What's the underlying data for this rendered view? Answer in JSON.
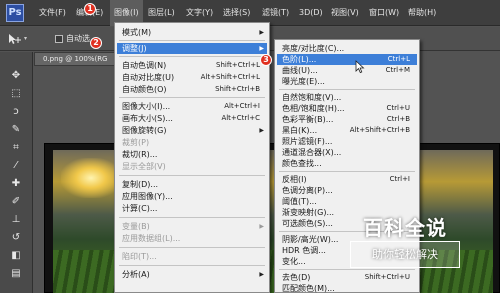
{
  "app": {
    "logo": "Ps"
  },
  "menubar": {
    "items": [
      {
        "label": "文件(F)"
      },
      {
        "label": "编辑(E)"
      },
      {
        "label": "图像(I)"
      },
      {
        "label": "图层(L)"
      },
      {
        "label": "文字(Y)"
      },
      {
        "label": "选择(S)"
      },
      {
        "label": "滤镜(T)"
      },
      {
        "label": "3D(D)"
      },
      {
        "label": "视图(V)"
      },
      {
        "label": "窗口(W)"
      },
      {
        "label": "帮助(H)"
      }
    ]
  },
  "options": {
    "auto_select_label": "自动选"
  },
  "document": {
    "tab_label": "0.png @ 100%(RG"
  },
  "image_menu": {
    "items": [
      {
        "label": "模式(M)",
        "shortcut": "",
        "submenu": true,
        "disabled": false
      },
      {
        "label": "调整(J)",
        "shortcut": "",
        "submenu": true,
        "disabled": false,
        "highlighted": true
      },
      {
        "label": "自动色调(N)",
        "shortcut": "Shift+Ctrl+L",
        "disabled": false
      },
      {
        "label": "自动对比度(U)",
        "shortcut": "Alt+Shift+Ctrl+L",
        "disabled": false
      },
      {
        "label": "自动颜色(O)",
        "shortcut": "Shift+Ctrl+B",
        "disabled": false
      },
      {
        "label": "图像大小(I)...",
        "shortcut": "Alt+Ctrl+I",
        "disabled": false
      },
      {
        "label": "画布大小(S)...",
        "shortcut": "Alt+Ctrl+C",
        "disabled": false
      },
      {
        "label": "图像旋转(G)",
        "shortcut": "",
        "submenu": true,
        "disabled": false
      },
      {
        "label": "裁剪(P)",
        "shortcut": "",
        "disabled": true
      },
      {
        "label": "裁切(R)...",
        "shortcut": "",
        "disabled": false
      },
      {
        "label": "显示全部(V)",
        "shortcut": "",
        "disabled": true
      },
      {
        "label": "复制(D)...",
        "shortcut": "",
        "disabled": false
      },
      {
        "label": "应用图像(Y)...",
        "shortcut": "",
        "disabled": false
      },
      {
        "label": "计算(C)...",
        "shortcut": "",
        "disabled": false
      },
      {
        "label": "变量(B)",
        "shortcut": "",
        "submenu": true,
        "disabled": true
      },
      {
        "label": "应用数据组(L)...",
        "shortcut": "",
        "disabled": true
      },
      {
        "label": "陷印(T)...",
        "shortcut": "",
        "disabled": true
      },
      {
        "label": "分析(A)",
        "shortcut": "",
        "submenu": true,
        "disabled": false
      }
    ]
  },
  "adjust_menu": {
    "items": [
      {
        "label": "亮度/对比度(C)...",
        "shortcut": ""
      },
      {
        "label": "色阶(L)...",
        "shortcut": "Ctrl+L",
        "highlighted": true
      },
      {
        "label": "曲线(U)...",
        "shortcut": "Ctrl+M"
      },
      {
        "label": "曝光度(E)...",
        "shortcut": ""
      },
      {
        "label": "自然饱和度(V)...",
        "shortcut": ""
      },
      {
        "label": "色相/饱和度(H)...",
        "shortcut": "Ctrl+U"
      },
      {
        "label": "色彩平衡(B)...",
        "shortcut": "Ctrl+B"
      },
      {
        "label": "黑白(K)...",
        "shortcut": "Alt+Shift+Ctrl+B"
      },
      {
        "label": "照片滤镜(F)...",
        "shortcut": ""
      },
      {
        "label": "通道混合器(X)...",
        "shortcut": ""
      },
      {
        "label": "颜色查找...",
        "shortcut": ""
      },
      {
        "label": "反相(I)",
        "shortcut": "Ctrl+I"
      },
      {
        "label": "色调分离(P)...",
        "shortcut": ""
      },
      {
        "label": "阈值(T)...",
        "shortcut": ""
      },
      {
        "label": "渐变映射(G)...",
        "shortcut": ""
      },
      {
        "label": "可选颜色(S)...",
        "shortcut": ""
      },
      {
        "label": "阴影/高光(W)...",
        "shortcut": ""
      },
      {
        "label": "HDR 色调...",
        "shortcut": ""
      },
      {
        "label": "变化...",
        "shortcut": ""
      },
      {
        "label": "去色(D)",
        "shortcut": "Shift+Ctrl+U"
      },
      {
        "label": "匹配颜色(M)...",
        "shortcut": ""
      }
    ]
  },
  "callouts": [
    "1",
    "2",
    "3"
  ],
  "watermark": {
    "title": "百科全说",
    "subtitle": "助你轻松解决"
  },
  "colors": {
    "highlight": "#3d7fd8",
    "badge": "#e03020",
    "menu_bg": "#f0f0f0"
  }
}
